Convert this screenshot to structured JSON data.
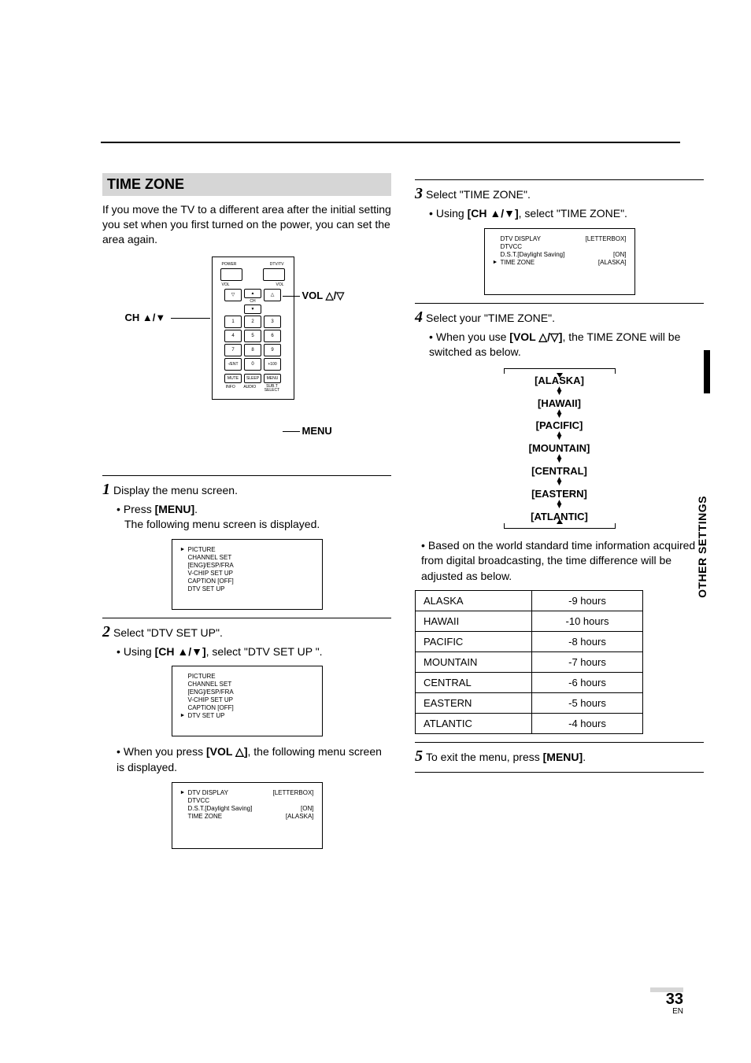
{
  "header": {
    "title": "TIME ZONE",
    "intro": "If you move the TV to a different area after the initial setting you set when you first turned on the power, you can set the area again."
  },
  "side_tab": "OTHER SETTINGS",
  "page_number": "33",
  "page_suffix": "EN",
  "remote": {
    "callout_ch": "CH ▲/▼",
    "callout_vol": "VOL △/▽",
    "callout_menu": "MENU",
    "top_labels_left": "POWER",
    "top_labels_right": "DTV/TV",
    "vol_left": "VOL",
    "vol_right": "VOL",
    "ch": "CH",
    "keys": [
      "1",
      "2",
      "3",
      "4",
      "5",
      "6",
      "7",
      "8",
      "9",
      "-/ENT",
      "0",
      "+100"
    ],
    "bottom1": [
      "MUTE",
      "SLEEP",
      "MENU"
    ],
    "bottom2": [
      "INFO",
      "AUDIO",
      "SUB.T\nSELECT"
    ]
  },
  "steps": {
    "s1": {
      "title": "Display the menu screen.",
      "press": "Press ",
      "press_btn": "[MENU]",
      "press_after": ".",
      "follow": "The following menu screen is displayed."
    },
    "s2": {
      "title": "Select \"DTV SET UP\".",
      "using": "Using ",
      "using_btn": "[CH ▲/▼]",
      "using_after": ", select \"DTV SET UP \".",
      "press": "When you press ",
      "press_btn": "[VOL △]",
      "press_after": ", the following menu screen is displayed."
    },
    "s3": {
      "title": "Select \"TIME ZONE\".",
      "using": "Using ",
      "using_btn": "[CH ▲/▼]",
      "using_after": ", select \"TIME ZONE\"."
    },
    "s4": {
      "title": "Select your \"TIME ZONE\".",
      "using": "When you use ",
      "using_btn": "[VOL △/▽]",
      "using_after": ", the TIME ZONE will be switched as below.",
      "note": "Based on the world standard time information acquired from digital broadcasting, the time difference will be adjusted as below."
    },
    "s5": {
      "title": "To exit the menu, press ",
      "btn": "[MENU]",
      "after": "."
    }
  },
  "menu1": {
    "pointer_row": 0,
    "rows": [
      "PICTURE",
      "CHANNEL SET",
      "[ENG]/ESP/FRA",
      "V-CHIP SET UP",
      "CAPTION [OFF]",
      "DTV SET UP"
    ]
  },
  "menu2": {
    "pointer_row": 5,
    "rows": [
      "PICTURE",
      "CHANNEL SET",
      "[ENG]/ESP/FRA",
      "V-CHIP SET UP",
      "CAPTION [OFF]",
      "DTV SET UP"
    ]
  },
  "menu3": {
    "pointer_row": 0,
    "rows": [
      {
        "l": "DTV DISPLAY",
        "r": "[LETTERBOX]"
      },
      {
        "l": "DTVCC",
        "r": ""
      },
      {
        "l": "D.S.T.[Daylight Saving]",
        "r": "[ON]"
      },
      {
        "l": "TIME ZONE",
        "r": "[ALASKA]"
      }
    ]
  },
  "menu4": {
    "pointer_row": 3,
    "rows": [
      {
        "l": "DTV DISPLAY",
        "r": "[LETTERBOX]"
      },
      {
        "l": "DTVCC",
        "r": ""
      },
      {
        "l": "D.S.T.[Daylight Saving]",
        "r": "[ON]"
      },
      {
        "l": "TIME ZONE",
        "r": "[ALASKA]"
      }
    ]
  },
  "tz_cycle": [
    "[ALASKA]",
    "[HAWAII]",
    "[PACIFIC]",
    "[MOUNTAIN]",
    "[CENTRAL]",
    "[EASTERN]",
    "[ATLANTIC]"
  ],
  "offset_table": [
    {
      "zone": "ALASKA",
      "offset": "-9 hours"
    },
    {
      "zone": "HAWAII",
      "offset": "-10 hours"
    },
    {
      "zone": "PACIFIC",
      "offset": "-8 hours"
    },
    {
      "zone": "MOUNTAIN",
      "offset": "-7 hours"
    },
    {
      "zone": "CENTRAL",
      "offset": "-6 hours"
    },
    {
      "zone": "EASTERN",
      "offset": "-5 hours"
    },
    {
      "zone": "ATLANTIC",
      "offset": "-4 hours"
    }
  ]
}
